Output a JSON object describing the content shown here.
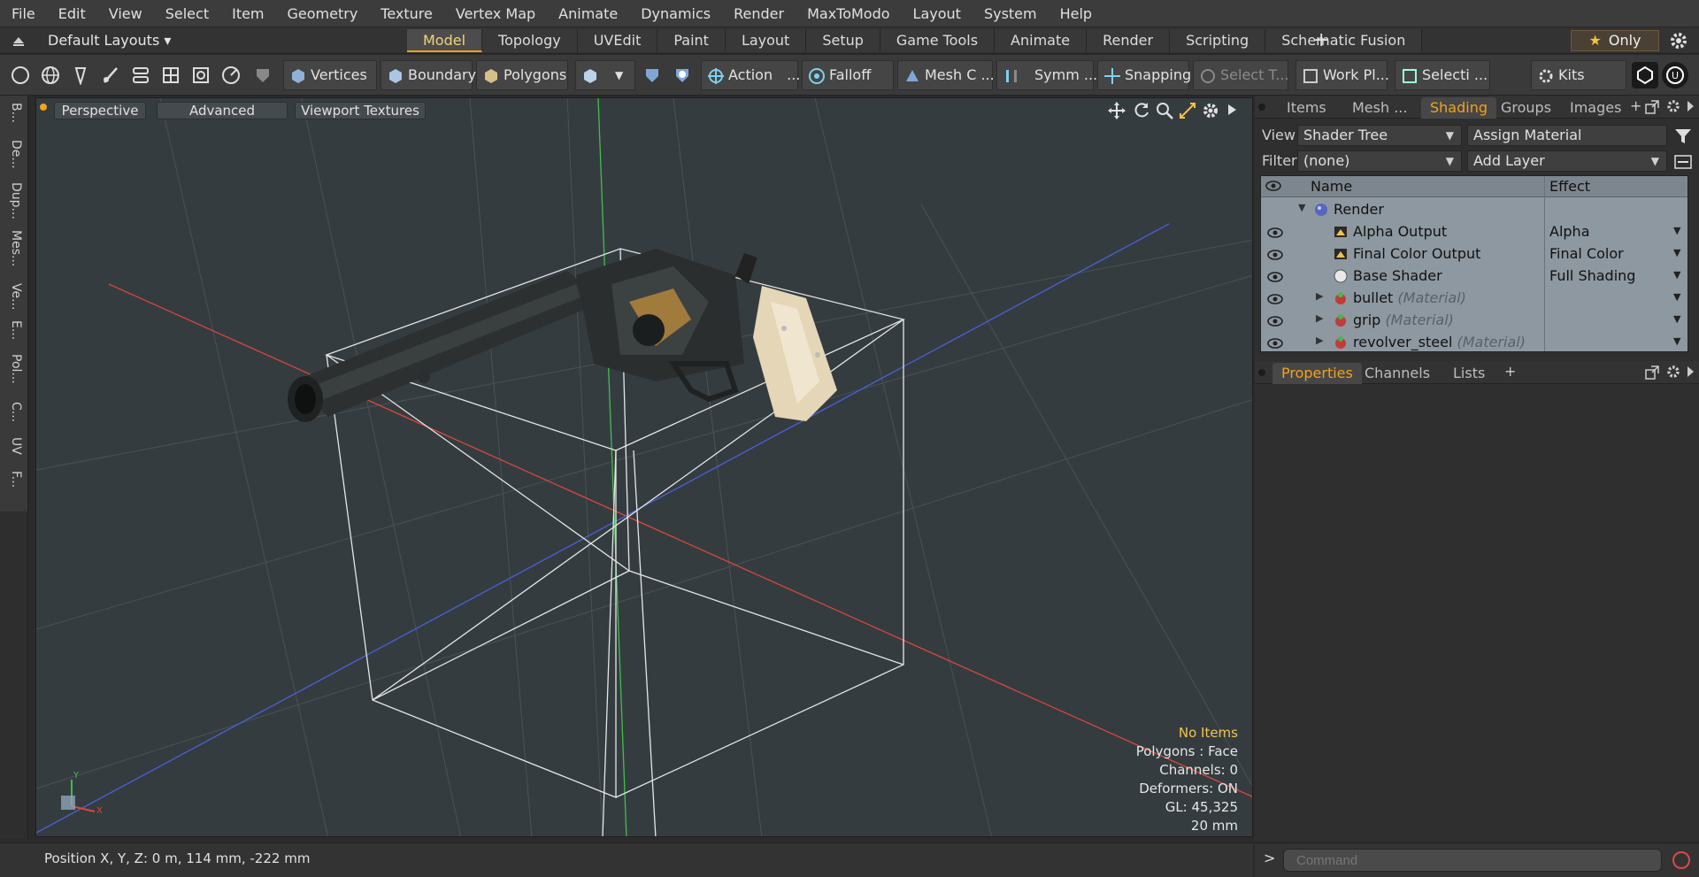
{
  "menu": [
    "File",
    "Edit",
    "View",
    "Select",
    "Item",
    "Geometry",
    "Texture",
    "Vertex Map",
    "Animate",
    "Dynamics",
    "Render",
    "MaxToModo",
    "Layout",
    "System",
    "Help"
  ],
  "layouts": {
    "dropdown": "Default Layouts ▾",
    "tabs": [
      "Model",
      "Topology",
      "UVEdit",
      "Paint",
      "Layout",
      "Setup",
      "Game Tools",
      "Animate",
      "Render",
      "Scripting",
      "Schematic Fusion"
    ],
    "active_tab": "Model",
    "add": "+",
    "only": "Only"
  },
  "toolbar": {
    "vertices": "Vertices",
    "boundary": "Boundary",
    "polygons": "Polygons",
    "action": "Action",
    "falloff": "Falloff",
    "mesh_c": "Mesh C ...",
    "symm": "Symm ...",
    "snapping": "Snapping",
    "select_t": "Select T...",
    "work_pl": "Work Pl...",
    "selecti": "Selecti ...",
    "kits": "Kits",
    "more": "..."
  },
  "leftstrip": [
    "B...",
    "De...",
    "Dup...",
    "Mes...",
    "Ve...",
    "E...",
    "Pol...",
    "C...",
    "UV",
    "F..."
  ],
  "viewport": {
    "perspective": "Perspective",
    "advanced": "Advanced",
    "textures": "Viewport Textures",
    "info": {
      "items": "No Items",
      "polygons": "Polygons : Face",
      "channels": "Channels: 0",
      "deformers": "Deformers: ON",
      "gl": "GL: 45,325",
      "grid": "20 mm"
    }
  },
  "status": {
    "position": "Position X, Y, Z:   0 m, 114 mm, -222 mm"
  },
  "panel_top": {
    "tabs": [
      "Items",
      "Mesh ...",
      "Shading",
      "Groups",
      "Images"
    ],
    "active_tab": "Shading",
    "view_label": "View",
    "view_value": "Shader Tree",
    "assign": "Assign Material",
    "filter_label": "Filter",
    "filter_value": "(none)",
    "add_layer": "Add Layer",
    "columns": {
      "name": "Name",
      "effect": "Effect"
    },
    "rows": [
      {
        "name": "Render",
        "sub": "",
        "effect": "",
        "indent": 0,
        "kind": "render"
      },
      {
        "name": "Alpha Output",
        "sub": "",
        "effect": "Alpha",
        "indent": 1,
        "kind": "output"
      },
      {
        "name": "Final Color Output",
        "sub": "",
        "effect": "Final Color",
        "indent": 1,
        "kind": "output"
      },
      {
        "name": "Base Shader",
        "sub": "",
        "effect": "Full Shading",
        "indent": 1,
        "kind": "shader"
      },
      {
        "name": "bullet",
        "sub": "(Material)",
        "effect": "",
        "indent": 1,
        "kind": "material"
      },
      {
        "name": "grip",
        "sub": "(Material)",
        "effect": "",
        "indent": 1,
        "kind": "material"
      },
      {
        "name": "revolver_steel",
        "sub": "(Material)",
        "effect": "",
        "indent": 1,
        "kind": "material"
      }
    ]
  },
  "panel_bottom": {
    "tabs": [
      "Properties",
      "Channels",
      "Lists"
    ],
    "active_tab": "Properties",
    "add": "+"
  },
  "command": {
    "prompt": ">",
    "placeholder": "Command"
  },
  "colors": {
    "accent": "#f2a21a",
    "viewport_bg": "#353c40",
    "axis_x": "#d9473c",
    "axis_y": "#3fbf4a",
    "axis_z": "#4b5fd8",
    "info_highlight": "#f2c24c"
  }
}
